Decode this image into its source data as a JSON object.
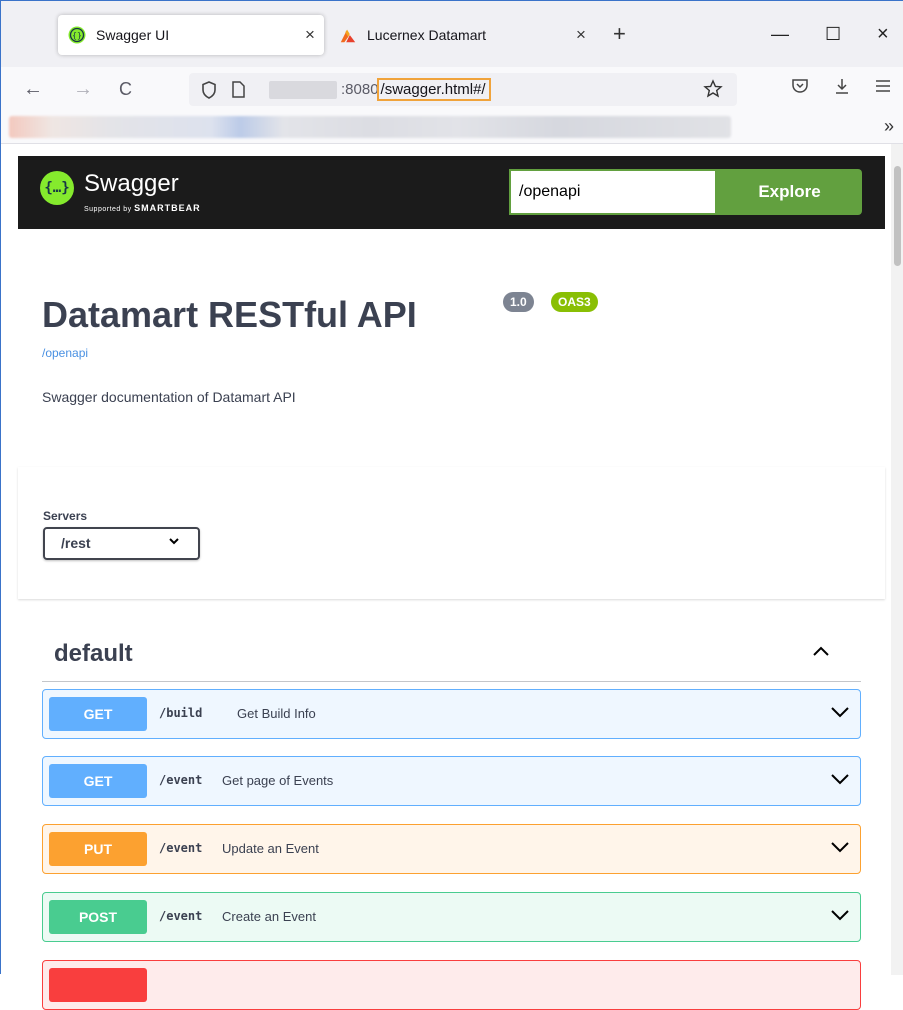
{
  "browser": {
    "tabs": [
      {
        "label": "Swagger UI",
        "close": "×"
      },
      {
        "label": "Lucernex Datamart",
        "close": "×"
      }
    ],
    "new_tab": "+",
    "window": {
      "minimize": "—",
      "maximize": "☐",
      "close": "×"
    },
    "nav": {
      "back": "←",
      "forward": "→",
      "reload": "C"
    },
    "address": {
      "host_suffix": ":8080",
      "path": "/swagger.html#/"
    },
    "bookmarks_overflow": "»"
  },
  "swagger": {
    "topbar": {
      "logo_glyph": "{…}",
      "brand": "Swagger",
      "brand_sub_prefix": "Supported by",
      "brand_sub_name": "SMARTBEAR",
      "url_value": "/openapi",
      "explore_label": "Explore"
    },
    "info": {
      "title": "Datamart RESTful API",
      "version": "1.0",
      "oas": "OAS3",
      "link": "/openapi",
      "description": "Swagger documentation of Datamart API"
    },
    "servers": {
      "label": "Servers",
      "selected": "/rest"
    },
    "tag": {
      "name": "default"
    },
    "operations": [
      {
        "method": "GET",
        "path": "/build",
        "summary": "Get Build Info"
      },
      {
        "method": "GET",
        "path": "/event",
        "summary": "Get page of Events"
      },
      {
        "method": "PUT",
        "path": "/event",
        "summary": "Update an Event"
      },
      {
        "method": "POST",
        "path": "/event",
        "summary": "Create an Event"
      },
      {
        "method": "",
        "path": "",
        "summary": ""
      }
    ]
  },
  "colors": {
    "get": "#61affe",
    "put": "#fca130",
    "post": "#49cc90",
    "delete": "#f93e3e",
    "swagger_green": "#62a03f",
    "highlight": "#f0a33b"
  }
}
